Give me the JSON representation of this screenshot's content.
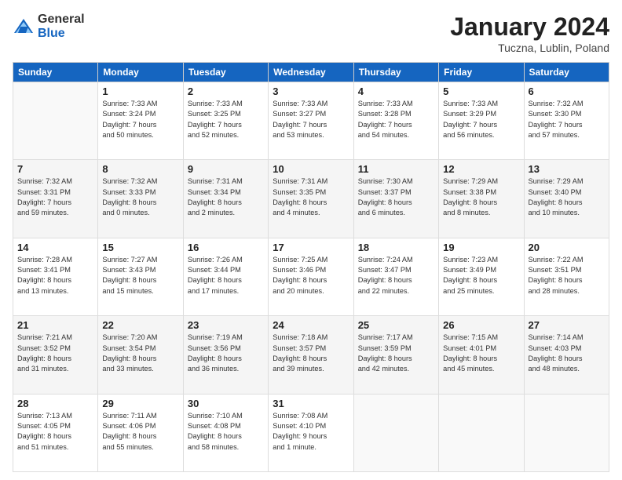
{
  "header": {
    "logo_general": "General",
    "logo_blue": "Blue",
    "month_year": "January 2024",
    "location": "Tuczna, Lublin, Poland"
  },
  "days_of_week": [
    "Sunday",
    "Monday",
    "Tuesday",
    "Wednesday",
    "Thursday",
    "Friday",
    "Saturday"
  ],
  "weeks": [
    [
      {
        "day": "",
        "content": ""
      },
      {
        "day": "1",
        "content": "Sunrise: 7:33 AM\nSunset: 3:24 PM\nDaylight: 7 hours\nand 50 minutes."
      },
      {
        "day": "2",
        "content": "Sunrise: 7:33 AM\nSunset: 3:25 PM\nDaylight: 7 hours\nand 52 minutes."
      },
      {
        "day": "3",
        "content": "Sunrise: 7:33 AM\nSunset: 3:27 PM\nDaylight: 7 hours\nand 53 minutes."
      },
      {
        "day": "4",
        "content": "Sunrise: 7:33 AM\nSunset: 3:28 PM\nDaylight: 7 hours\nand 54 minutes."
      },
      {
        "day": "5",
        "content": "Sunrise: 7:33 AM\nSunset: 3:29 PM\nDaylight: 7 hours\nand 56 minutes."
      },
      {
        "day": "6",
        "content": "Sunrise: 7:32 AM\nSunset: 3:30 PM\nDaylight: 7 hours\nand 57 minutes."
      }
    ],
    [
      {
        "day": "7",
        "content": "Sunrise: 7:32 AM\nSunset: 3:31 PM\nDaylight: 7 hours\nand 59 minutes."
      },
      {
        "day": "8",
        "content": "Sunrise: 7:32 AM\nSunset: 3:33 PM\nDaylight: 8 hours\nand 0 minutes."
      },
      {
        "day": "9",
        "content": "Sunrise: 7:31 AM\nSunset: 3:34 PM\nDaylight: 8 hours\nand 2 minutes."
      },
      {
        "day": "10",
        "content": "Sunrise: 7:31 AM\nSunset: 3:35 PM\nDaylight: 8 hours\nand 4 minutes."
      },
      {
        "day": "11",
        "content": "Sunrise: 7:30 AM\nSunset: 3:37 PM\nDaylight: 8 hours\nand 6 minutes."
      },
      {
        "day": "12",
        "content": "Sunrise: 7:29 AM\nSunset: 3:38 PM\nDaylight: 8 hours\nand 8 minutes."
      },
      {
        "day": "13",
        "content": "Sunrise: 7:29 AM\nSunset: 3:40 PM\nDaylight: 8 hours\nand 10 minutes."
      }
    ],
    [
      {
        "day": "14",
        "content": "Sunrise: 7:28 AM\nSunset: 3:41 PM\nDaylight: 8 hours\nand 13 minutes."
      },
      {
        "day": "15",
        "content": "Sunrise: 7:27 AM\nSunset: 3:43 PM\nDaylight: 8 hours\nand 15 minutes."
      },
      {
        "day": "16",
        "content": "Sunrise: 7:26 AM\nSunset: 3:44 PM\nDaylight: 8 hours\nand 17 minutes."
      },
      {
        "day": "17",
        "content": "Sunrise: 7:25 AM\nSunset: 3:46 PM\nDaylight: 8 hours\nand 20 minutes."
      },
      {
        "day": "18",
        "content": "Sunrise: 7:24 AM\nSunset: 3:47 PM\nDaylight: 8 hours\nand 22 minutes."
      },
      {
        "day": "19",
        "content": "Sunrise: 7:23 AM\nSunset: 3:49 PM\nDaylight: 8 hours\nand 25 minutes."
      },
      {
        "day": "20",
        "content": "Sunrise: 7:22 AM\nSunset: 3:51 PM\nDaylight: 8 hours\nand 28 minutes."
      }
    ],
    [
      {
        "day": "21",
        "content": "Sunrise: 7:21 AM\nSunset: 3:52 PM\nDaylight: 8 hours\nand 31 minutes."
      },
      {
        "day": "22",
        "content": "Sunrise: 7:20 AM\nSunset: 3:54 PM\nDaylight: 8 hours\nand 33 minutes."
      },
      {
        "day": "23",
        "content": "Sunrise: 7:19 AM\nSunset: 3:56 PM\nDaylight: 8 hours\nand 36 minutes."
      },
      {
        "day": "24",
        "content": "Sunrise: 7:18 AM\nSunset: 3:57 PM\nDaylight: 8 hours\nand 39 minutes."
      },
      {
        "day": "25",
        "content": "Sunrise: 7:17 AM\nSunset: 3:59 PM\nDaylight: 8 hours\nand 42 minutes."
      },
      {
        "day": "26",
        "content": "Sunrise: 7:15 AM\nSunset: 4:01 PM\nDaylight: 8 hours\nand 45 minutes."
      },
      {
        "day": "27",
        "content": "Sunrise: 7:14 AM\nSunset: 4:03 PM\nDaylight: 8 hours\nand 48 minutes."
      }
    ],
    [
      {
        "day": "28",
        "content": "Sunrise: 7:13 AM\nSunset: 4:05 PM\nDaylight: 8 hours\nand 51 minutes."
      },
      {
        "day": "29",
        "content": "Sunrise: 7:11 AM\nSunset: 4:06 PM\nDaylight: 8 hours\nand 55 minutes."
      },
      {
        "day": "30",
        "content": "Sunrise: 7:10 AM\nSunset: 4:08 PM\nDaylight: 8 hours\nand 58 minutes."
      },
      {
        "day": "31",
        "content": "Sunrise: 7:08 AM\nSunset: 4:10 PM\nDaylight: 9 hours\nand 1 minute."
      },
      {
        "day": "",
        "content": ""
      },
      {
        "day": "",
        "content": ""
      },
      {
        "day": "",
        "content": ""
      }
    ]
  ]
}
